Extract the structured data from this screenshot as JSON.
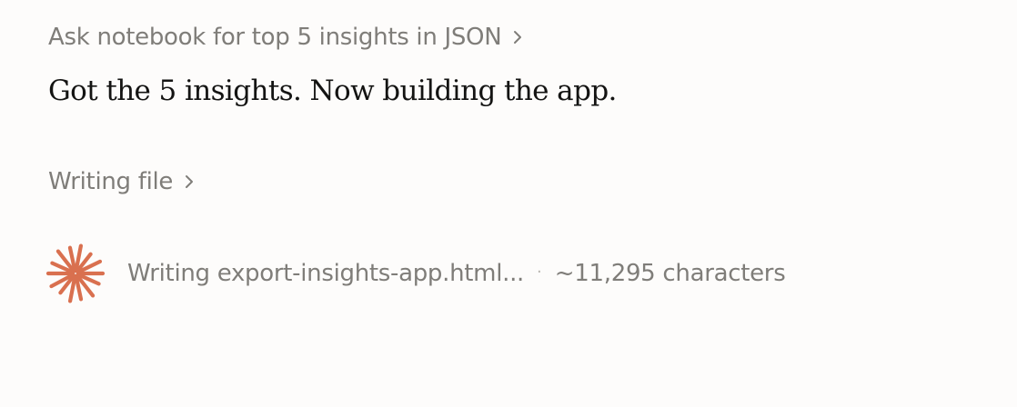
{
  "steps": [
    {
      "label": "Ask notebook for top 5 insights in JSON"
    },
    {
      "label": "Writing file"
    }
  ],
  "message": "Got the 5 insights. Now building the app.",
  "status": {
    "text": "Writing export-insights-app.html...",
    "separator": "·",
    "meta": "~11,295 characters",
    "icon": "spark-icon",
    "icon_color": "#d9704f"
  }
}
